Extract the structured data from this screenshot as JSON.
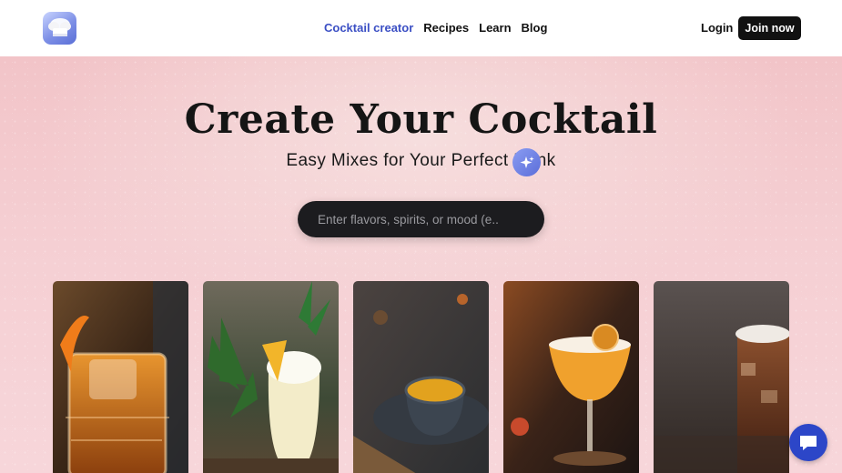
{
  "header": {
    "nav": [
      {
        "label": "Cocktail creator",
        "active": true
      },
      {
        "label": "Recipes",
        "active": false
      },
      {
        "label": "Learn",
        "active": false
      },
      {
        "label": "Blog",
        "active": false
      }
    ],
    "login_label": "Login",
    "join_label": "Join now"
  },
  "hero": {
    "title": "Create Your Cocktail",
    "subtitle": "Easy Mixes for Your Perfect Drink",
    "search_placeholder": "Enter flavors, spirits, or mood (e...."
  },
  "cards": [
    {
      "icon": "old-fashioned-cocktail-photo"
    },
    {
      "icon": "pina-colada-cocktail-photo"
    },
    {
      "icon": "tea-cup-photo"
    },
    {
      "icon": "sour-coupe-cocktail-photo"
    },
    {
      "icon": "iced-cola-cocktail-photo"
    }
  ],
  "icons": {
    "logo": "chef-hat-logo-icon",
    "search_action": "sparkle-icon",
    "chat": "chat-bubble-icon"
  },
  "colors": {
    "accent": "#3b4fc4",
    "join_button": "#111111",
    "chat_button": "#2c46c8",
    "hero_background": "#f2c4c8",
    "search_background": "#1c1c1f"
  }
}
